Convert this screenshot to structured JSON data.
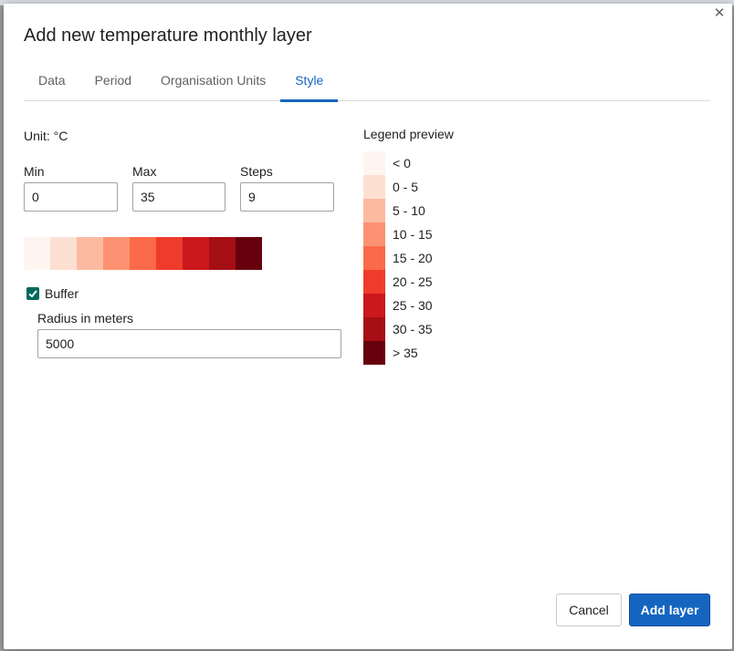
{
  "dialog": {
    "title": "Add new temperature monthly layer",
    "close_glyph": "✕"
  },
  "tabs": [
    {
      "label": "Data"
    },
    {
      "label": "Period"
    },
    {
      "label": "Organisation Units"
    },
    {
      "label": "Style"
    }
  ],
  "active_tab": "Style",
  "style": {
    "unit": "Unit: °C",
    "min": {
      "label": "Min",
      "value": "0"
    },
    "max": {
      "label": "Max",
      "value": "35"
    },
    "steps": {
      "label": "Steps",
      "value": "9"
    },
    "scale_colors": [
      "#fff5f0",
      "#fee0d2",
      "#fcbba1",
      "#fc9272",
      "#fb6a4a",
      "#ef3b2c",
      "#cb181d",
      "#a50f15",
      "#67000d"
    ],
    "buffer": {
      "label": "Buffer",
      "checked": true
    },
    "radius": {
      "label": "Radius in meters",
      "value": "5000"
    }
  },
  "legend": {
    "title": "Legend preview",
    "items": [
      {
        "label": "< 0",
        "color": "#fff5f0"
      },
      {
        "label": "0 - 5",
        "color": "#fee0d2"
      },
      {
        "label": "5 - 10",
        "color": "#fcbba1"
      },
      {
        "label": "10 - 15",
        "color": "#fc9272"
      },
      {
        "label": "15 - 20",
        "color": "#fb6a4a"
      },
      {
        "label": "20 - 25",
        "color": "#ef3b2c"
      },
      {
        "label": "25 - 30",
        "color": "#cb181d"
      },
      {
        "label": "30 - 35",
        "color": "#a50f15"
      },
      {
        "label": "> 35",
        "color": "#67000d"
      }
    ]
  },
  "actions": {
    "cancel_label": "Cancel",
    "add_label": "Add layer"
  },
  "colors": {
    "accent": "#1565c0",
    "checkbox": "#00695c"
  }
}
